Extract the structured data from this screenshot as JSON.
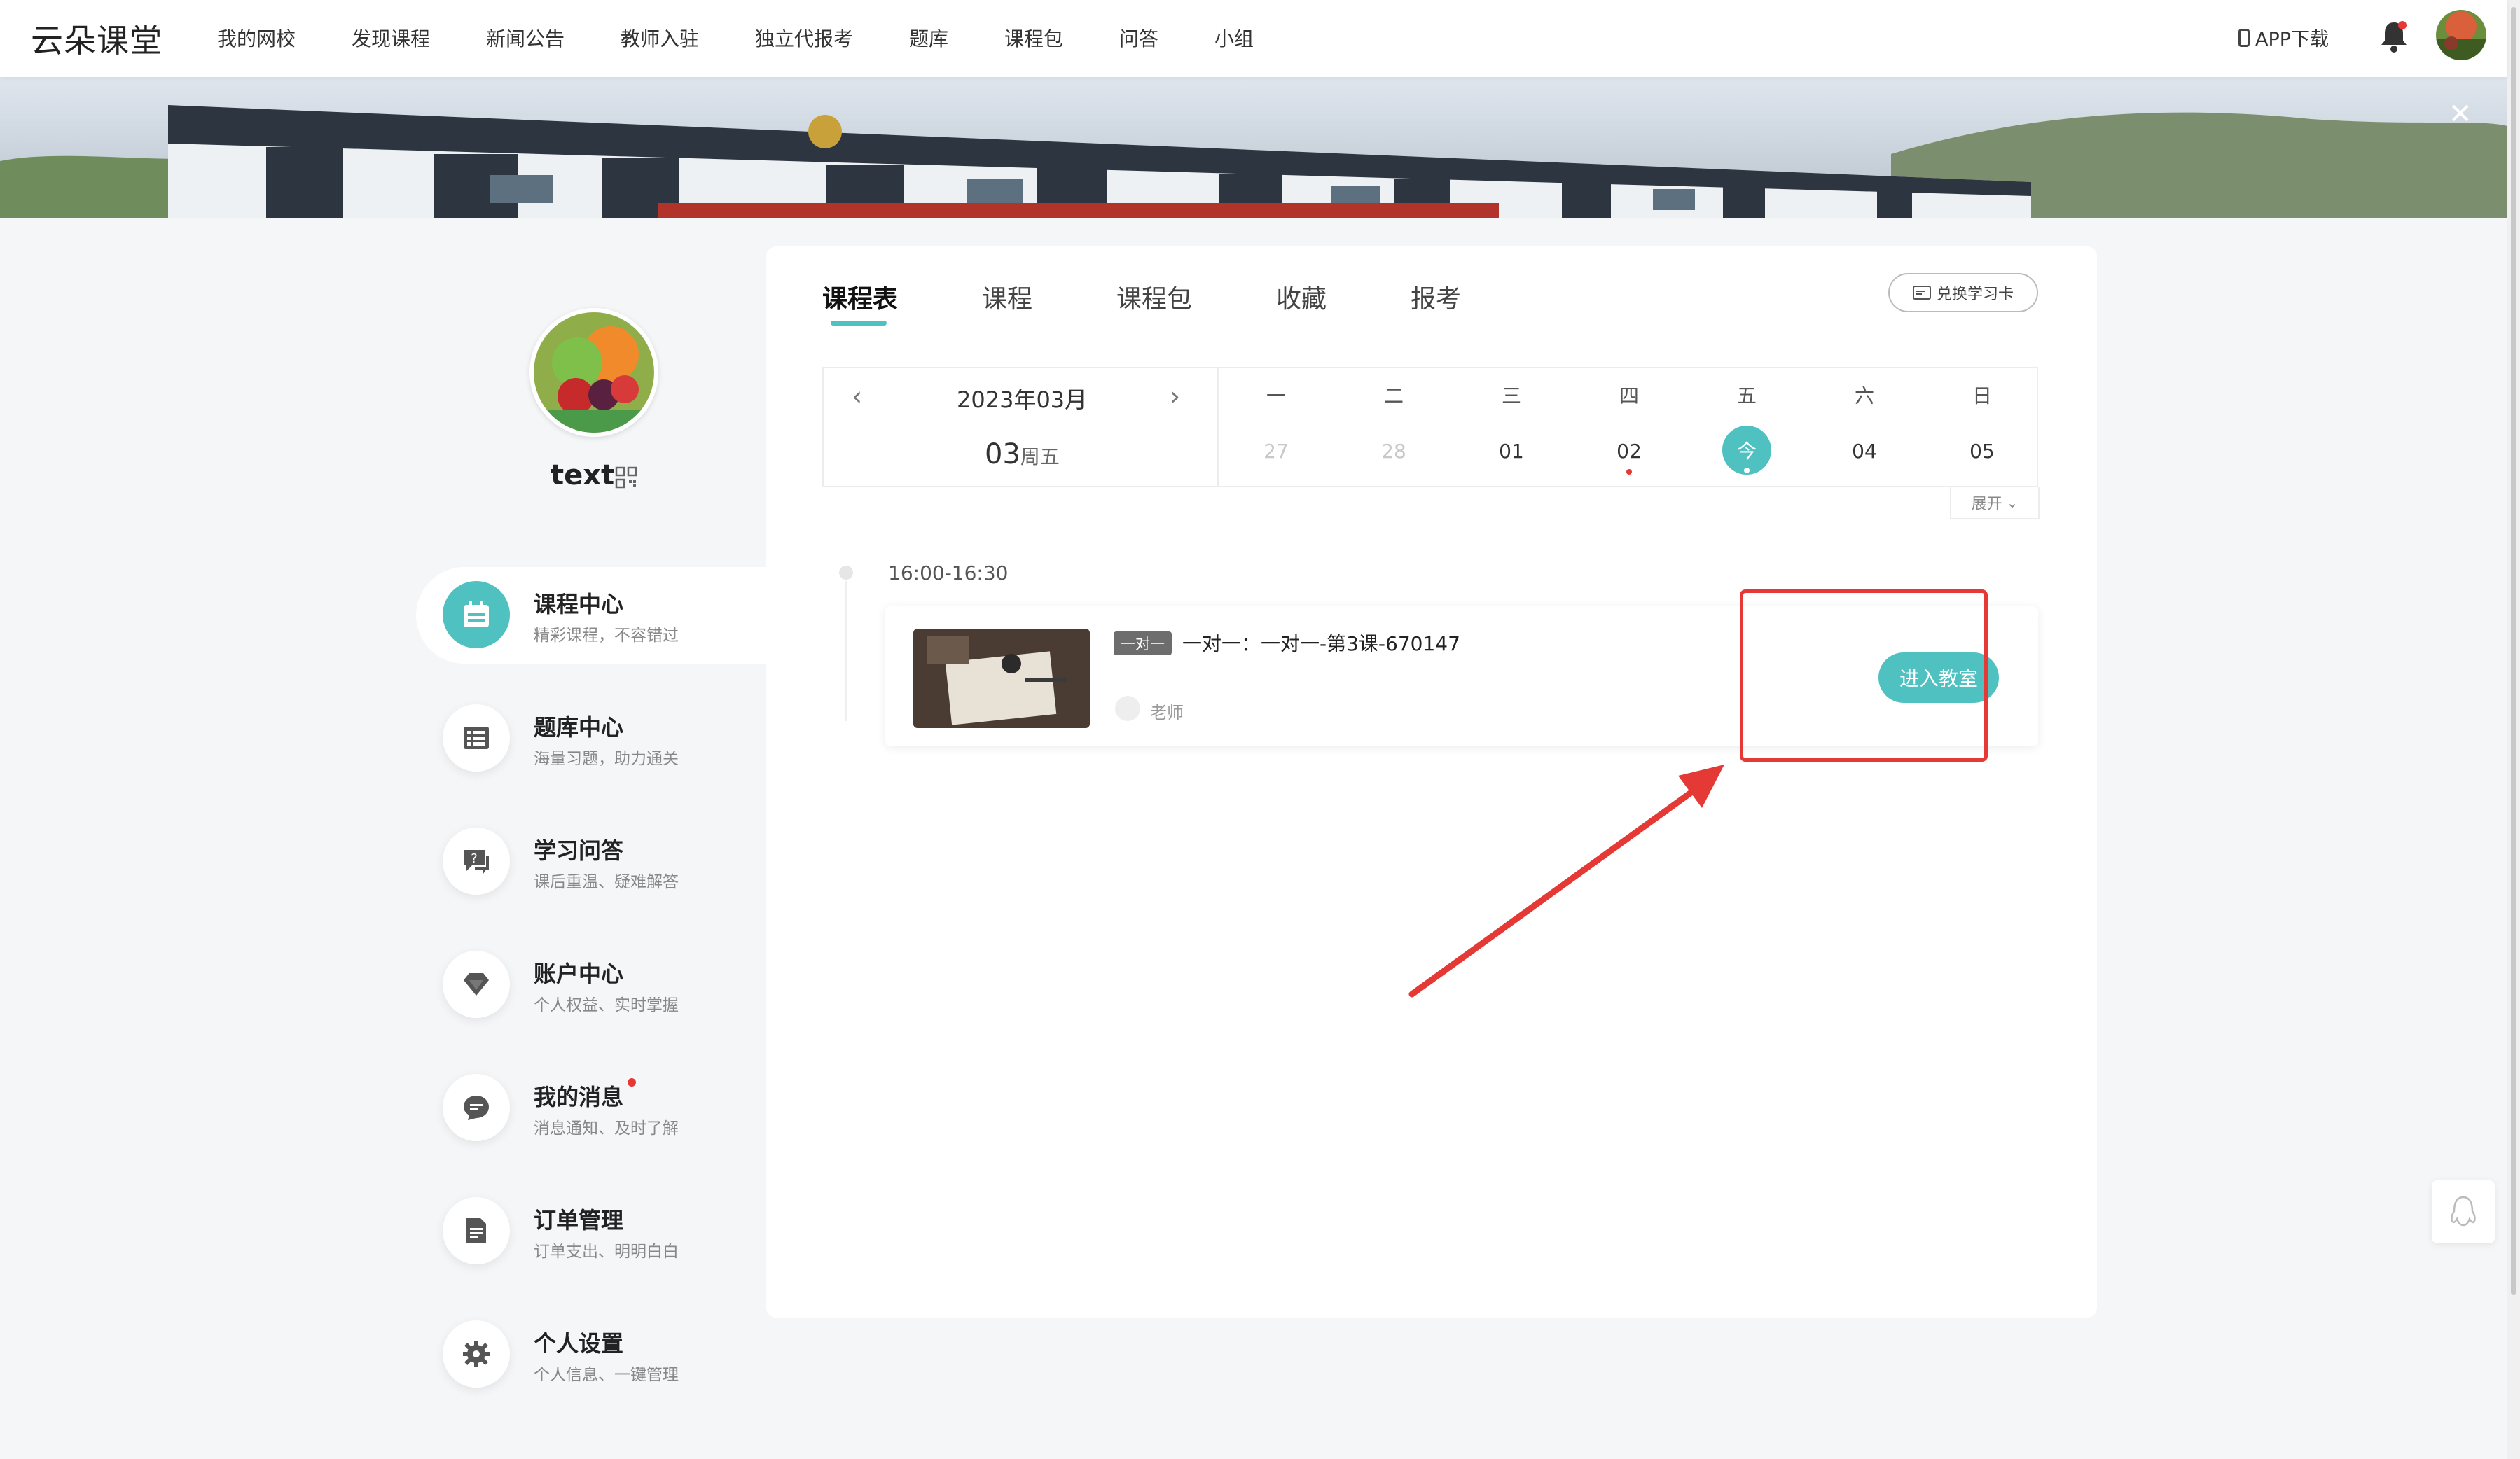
{
  "nav": {
    "logo": "云朵课堂",
    "links": [
      "我的网校",
      "发现课程",
      "新闻公告",
      "教师入驻",
      "独立代报考",
      "题库",
      "课程包",
      "问答",
      "小组"
    ],
    "app_download": "APP下载"
  },
  "banner": {
    "close_icon": "close-icon"
  },
  "profile": {
    "name": "text"
  },
  "sidebar": {
    "items": [
      {
        "title": "课程中心",
        "subtitle": "精彩课程，不容错过",
        "icon": "calendar-icon"
      },
      {
        "title": "题库中心",
        "subtitle": "海量习题，助力通关",
        "icon": "list-icon"
      },
      {
        "title": "学习问答",
        "subtitle": "课后重温、疑难解答",
        "icon": "question-chat-icon"
      },
      {
        "title": "账户中心",
        "subtitle": "个人权益、实时掌握",
        "icon": "diamond-icon"
      },
      {
        "title": "我的消息",
        "subtitle": "消息通知、及时了解",
        "icon": "message-icon"
      },
      {
        "title": "订单管理",
        "subtitle": "订单支出、明明白白",
        "icon": "document-icon"
      },
      {
        "title": "个人设置",
        "subtitle": "个人信息、一键管理",
        "icon": "gear-icon"
      }
    ]
  },
  "tabs": [
    "课程表",
    "课程",
    "课程包",
    "收藏",
    "报考"
  ],
  "redeem_label": "兑换学习卡",
  "calendar": {
    "month": "2023年03月",
    "current_day": "03",
    "current_weekday": "周五",
    "weekdays": [
      "一",
      "二",
      "三",
      "四",
      "五",
      "六",
      "日"
    ],
    "dates": [
      "27",
      "28",
      "01",
      "02",
      "今",
      "04",
      "05"
    ],
    "expand": "展开"
  },
  "schedule": {
    "time": "16:00-16:30",
    "tag": "一对一",
    "title": "一对一：一对一-第3课-670147",
    "teacher": "老师",
    "enter_label": "进入教室"
  },
  "colors": {
    "accent": "#4fc1c1",
    "annotation": "#e53935"
  }
}
